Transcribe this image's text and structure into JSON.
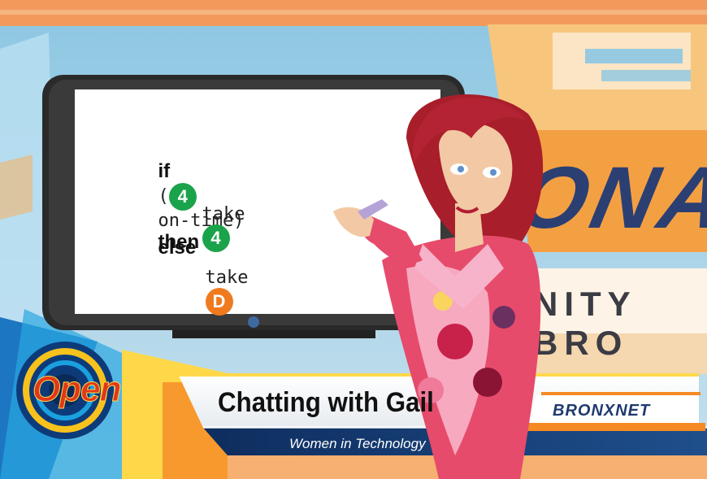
{
  "screen": {
    "board": {
      "line1": {
        "if": "if",
        "open": "(",
        "cond": "on-time)",
        "then": "then",
        "badge": "4",
        "badge_color": "#1aa34a"
      },
      "line2": {
        "take": "take",
        "badge": "4",
        "badge_color": "#1aa34a"
      },
      "line3": {
        "else": "else"
      },
      "line4": {
        "take": "take",
        "badge": "D",
        "badge_color": "#f07a1e"
      }
    },
    "background_text": {
      "big": "ONA",
      "wide": "NITY BRO"
    },
    "lower_third": {
      "show_logo": "Open",
      "title": "Chatting with Gail",
      "subtitle": "Women in Technology",
      "network": "BRONXNET"
    }
  }
}
